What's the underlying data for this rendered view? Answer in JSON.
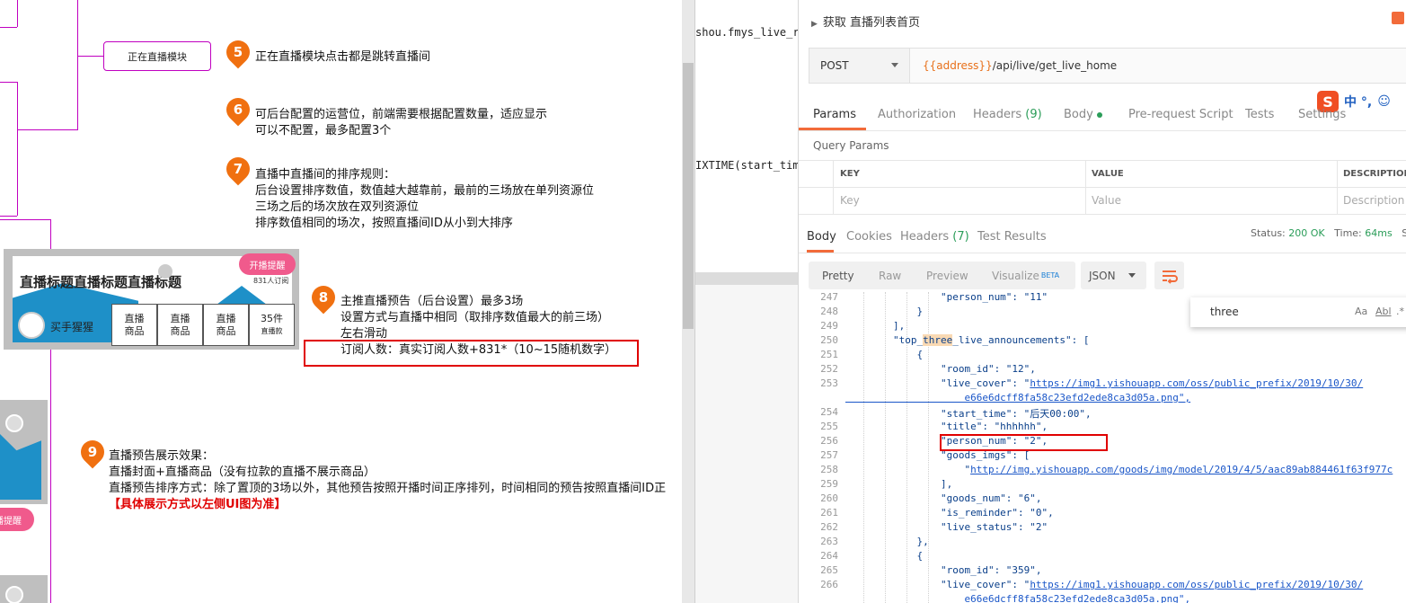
{
  "left_doc": {
    "module_box": "正在直播模块",
    "notes": {
      "n5": {
        "num": "5",
        "lines": [
          "正在直播模块点击都是跳转直播间"
        ]
      },
      "n6": {
        "num": "6",
        "lines": [
          "可后台配置的运营位，前端需要根据配置数量，适应显示",
          "可以不配置，最多配置3个"
        ]
      },
      "n7": {
        "num": "7",
        "lines": [
          "直播中直播间的排序规则：",
          "后台设置排序数值，数值越大越靠前，最前的三场放在单列资源位",
          "三场之后的场次放在双列资源位",
          "排序数值相同的场次，按照直播间ID从小到大排序"
        ]
      },
      "n8": {
        "num": "8",
        "lines": [
          "主推直播预告（后台设置）最多3场",
          "设置方式与直播中相同（取排序数值最大的前三场）",
          "左右滑动",
          "订阅人数：真实订阅人数+831*（10~15随机数字）"
        ]
      },
      "n9": {
        "num": "9",
        "lines": [
          "直播预告展示效果：",
          "直播封面+直播商品（没有拉款的直播不展示商品）",
          "直播预告排序方式：除了置顶的3场以外，其他预告按照开播时间正序排列，时间相同的预告按照直播间ID正"
        ],
        "red": "【具体展示方式以左侧UI图为准】"
      }
    },
    "card": {
      "title": "直播标题直播标题直播标题",
      "remind_btn": "开播提醒",
      "subscribers": "831人订阅",
      "host": "买手猩猩",
      "goods": [
        "直播\n商品",
        "直播\n商品",
        "直播\n商品"
      ],
      "count_main": "35件",
      "count_sub": "直播款"
    },
    "second_remind": "播提醒"
  },
  "middle": {
    "code_line_1": "shou.fmys_live_ro",
    "code_line_2": "IXTIME(start_time"
  },
  "postman": {
    "request_title": "获取 直播列表首页",
    "method": "POST",
    "url_var": "{{address}}",
    "url_path": "/api/live/get_live_home",
    "request_tabs": [
      {
        "label": "Params",
        "active": true
      },
      {
        "label": "Authorization"
      },
      {
        "label": "Headers",
        "count": "(9)"
      },
      {
        "label": "Body",
        "dot": true
      },
      {
        "label": "Pre-request Script"
      },
      {
        "label": "Tests"
      },
      {
        "label": "Settings"
      }
    ],
    "query_params_label": "Query Params",
    "table_headers": [
      "KEY",
      "VALUE",
      "DESCRIPTION"
    ],
    "table_placeholders": [
      "Key",
      "Value",
      "Description"
    ],
    "response_tabs": [
      {
        "label": "Body",
        "active": true
      },
      {
        "label": "Cookies"
      },
      {
        "label": "Headers",
        "count": "(7)"
      },
      {
        "label": "Test Results"
      }
    ],
    "status_label": "Status:",
    "status_value": "200 OK",
    "time_label": "Time:",
    "time_value": "64ms",
    "size_label": "S",
    "view_buttons": [
      "Pretty",
      "Raw",
      "Preview",
      "Visualize"
    ],
    "beta": "BETA",
    "format": "JSON",
    "search_text": "three",
    "search_opts": [
      "Aa",
      "Abl",
      ".*"
    ],
    "ime_text": "中 °,",
    "code_lines": [
      {
        "n": "247",
        "t": "                \"person_num\": \"11\""
      },
      {
        "n": "248",
        "t": "            }"
      },
      {
        "n": "249",
        "t": "        ],"
      },
      {
        "n": "250",
        "t": "        \"top_three_live_announcements\": ["
      },
      {
        "n": "251",
        "t": "            {"
      },
      {
        "n": "252",
        "t": "                \"room_id\": \"12\","
      },
      {
        "n": "253",
        "t": "                \"live_cover\": \"https://img1.yishouapp.com/oss/public_prefix/2019/10/30/"
      },
      {
        "n": "",
        "t": "                    e66e6dcff8fa58c23efd2ede8ca3d05a.png\","
      },
      {
        "n": "254",
        "t": "                \"start_time\": \"后天00:00\","
      },
      {
        "n": "255",
        "t": "                \"title\": \"hhhhhh\","
      },
      {
        "n": "256",
        "t": "                \"person_num\": \"2\","
      },
      {
        "n": "257",
        "t": "                \"goods_imgs\": ["
      },
      {
        "n": "258",
        "t": "                    \"http://img.yishouapp.com/goods/img/model/2019/4/5/aac89ab884461f63f977c"
      },
      {
        "n": "259",
        "t": "                ],"
      },
      {
        "n": "260",
        "t": "                \"goods_num\": \"6\","
      },
      {
        "n": "261",
        "t": "                \"is_reminder\": \"0\","
      },
      {
        "n": "262",
        "t": "                \"live_status\": \"2\""
      },
      {
        "n": "263",
        "t": "            },"
      },
      {
        "n": "264",
        "t": "            {"
      },
      {
        "n": "265",
        "t": "                \"room_id\": \"359\","
      },
      {
        "n": "266",
        "t": "                \"live_cover\": \"https://img1.yishouapp.com/oss/public_prefix/2019/10/30/"
      },
      {
        "n": "",
        "t": "                    e66e6dcff8fa58c23efd2ede8ca3d05a.png\","
      }
    ]
  },
  "colors": {
    "accent": "#f26b3a",
    "annotation_line": "#c000c0",
    "pin": "#f07010",
    "highlight": "#e00000",
    "pink": "#f05a8c",
    "status_green": "#2b9d59"
  }
}
